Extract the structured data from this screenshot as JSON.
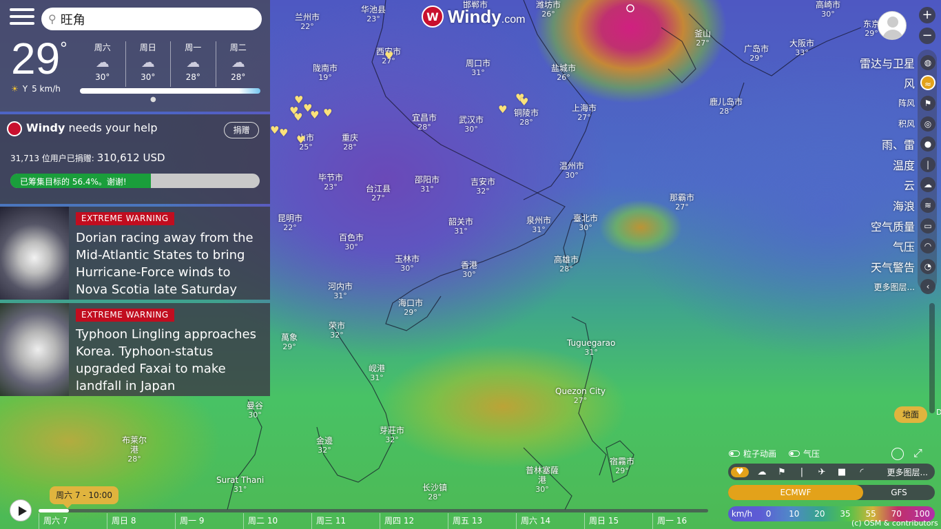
{
  "app": {
    "logo_main": "Windy",
    "logo_suffix": ".com"
  },
  "search": {
    "value": "旺角",
    "placeholder": "旺角"
  },
  "current": {
    "temperature": "29",
    "unit": "°",
    "wind": "5 km/h"
  },
  "forecast_days": [
    {
      "name": "周六",
      "temp": "30°",
      "icon": "thunderstorm-icon"
    },
    {
      "name": "周日",
      "temp": "30°",
      "icon": "thunderstorm-icon"
    },
    {
      "name": "周一",
      "temp": "28°",
      "icon": "thunderstorm-icon"
    },
    {
      "name": "周二",
      "temp": "28°",
      "icon": "thunderstorm-icon"
    }
  ],
  "help": {
    "brand": "Windy",
    "title_rest": "needs your help",
    "donate": "捐赠",
    "donors_text": "31,713 位用户已捐赠:",
    "amount": "310,612 USD",
    "progress_text": "已筹集目标的 56.4%。谢谢!",
    "progress_fraction": 0.564
  },
  "news": [
    {
      "badge": "EXTREME WARNING",
      "title": "Dorian racing away from the Mid-Atlantic States to bring Hurricane-Force winds to Nova Scotia late Saturday"
    },
    {
      "badge": "EXTREME WARNING",
      "title": "Typhoon Lingling approaches Korea. Typhoon-status upgraded Faxai to make landfall in Japan"
    }
  ],
  "cities": [
    {
      "name": "兰州市",
      "temp": "22°"
    },
    {
      "name": "华池县",
      "temp": "23°"
    },
    {
      "name": "邯郸市",
      "temp": ""
    },
    {
      "name": "潍坊市",
      "temp": "26°"
    },
    {
      "name": "高崎市",
      "temp": "30°"
    },
    {
      "name": "东京",
      "temp": "29°"
    },
    {
      "name": "釜山",
      "temp": "27°"
    },
    {
      "name": "大阪市",
      "temp": "33°"
    },
    {
      "name": "广岛市",
      "temp": "29°"
    },
    {
      "name": "西安市",
      "temp": "27°"
    },
    {
      "name": "陇南市",
      "temp": "19°"
    },
    {
      "name": "周口市",
      "temp": "31°"
    },
    {
      "name": "盐城市",
      "temp": "26°"
    },
    {
      "name": "鹿儿岛市",
      "temp": "28°"
    },
    {
      "name": "宜昌市",
      "temp": "28°"
    },
    {
      "name": "武汉市",
      "temp": "30°"
    },
    {
      "name": "铜陵市",
      "temp": "28°"
    },
    {
      "name": "上海市",
      "temp": "27°"
    },
    {
      "name": "重庆",
      "temp": "28°"
    },
    {
      "name": "山市",
      "temp": "25°"
    },
    {
      "name": "温州市",
      "temp": "30°"
    },
    {
      "name": "毕节市",
      "temp": "23°"
    },
    {
      "name": "台江县",
      "temp": "27°"
    },
    {
      "name": "邵阳市",
      "temp": "31°"
    },
    {
      "name": "吉安市",
      "temp": "32°"
    },
    {
      "name": "那霸市",
      "temp": "27°"
    },
    {
      "name": "昆明市",
      "temp": "22°"
    },
    {
      "name": "韶关市",
      "temp": "31°"
    },
    {
      "name": "泉州市",
      "temp": "31°"
    },
    {
      "name": "臺北市",
      "temp": "30°"
    },
    {
      "name": "百色市",
      "temp": "30°"
    },
    {
      "name": "玉林市",
      "temp": "30°"
    },
    {
      "name": "香港",
      "temp": "30°"
    },
    {
      "name": "高雄市",
      "temp": "28°"
    },
    {
      "name": "河内市",
      "temp": "31°"
    },
    {
      "name": "海口市",
      "temp": "29°"
    },
    {
      "name": "荣市",
      "temp": "32°"
    },
    {
      "name": "萬象",
      "temp": "29°"
    },
    {
      "name": "岘港",
      "temp": "31°"
    },
    {
      "name": "Tuguegarao",
      "temp": "31°"
    },
    {
      "name": "Quezon City",
      "temp": "27°"
    },
    {
      "name": "曼谷",
      "temp": "30°"
    },
    {
      "name": "芽莊市",
      "temp": "32°"
    },
    {
      "name": "金邊",
      "temp": "32°"
    },
    {
      "name": "布莱尔港",
      "temp": "28°"
    },
    {
      "name": "Surat Thani",
      "temp": "31°"
    },
    {
      "name": "长沙镇",
      "temp": "28°"
    },
    {
      "name": "普林塞薩港",
      "temp": "30°"
    },
    {
      "name": "宿霧市",
      "temp": "29°"
    }
  ],
  "layers": [
    {
      "label": "雷达与卫星",
      "icon": "globe-icon",
      "small": false
    },
    {
      "label": "风",
      "icon": "wind-icon",
      "small": false,
      "active": true
    },
    {
      "label": "阵风",
      "icon": "flag-icon",
      "small": true
    },
    {
      "label": "积风",
      "icon": "swirl-icon",
      "small": true
    },
    {
      "label": "雨、雷",
      "icon": "raindrop-icon",
      "small": false
    },
    {
      "label": "温度",
      "icon": "thermometer-icon",
      "small": false
    },
    {
      "label": "云",
      "icon": "cloud-icon",
      "small": false
    },
    {
      "label": "海浪",
      "icon": "waves-icon",
      "small": false
    },
    {
      "label": "空气质量",
      "icon": "car-icon",
      "small": false
    },
    {
      "label": "气压",
      "icon": "gauge-icon",
      "small": false
    },
    {
      "label": "天气警告",
      "icon": "warning-icon",
      "small": false
    },
    {
      "label": "更多图层...",
      "icon": "chevron-left-icon",
      "small": true
    }
  ],
  "ground_button": "地面",
  "ground_d": "D",
  "toggles": {
    "particles": "粒子动画",
    "pressure": "气压"
  },
  "quick_layers_more": "更多图层...",
  "models": {
    "active": "ECMWF",
    "other": "GFS"
  },
  "legend": {
    "unit": "km/h",
    "values": [
      "0",
      "10",
      "20",
      "35",
      "55",
      "70",
      "100"
    ]
  },
  "credit": "(c) OSM & contributors",
  "timeline": {
    "current": "周六 7 - 10:00",
    "progress_fraction": 0.045,
    "days": [
      "周六 7",
      "周日 8",
      "周一 9",
      "周二 10",
      "周三 11",
      "周四 12",
      "周五 13",
      "周六 14",
      "周日 15",
      "周一 16"
    ]
  },
  "colors": {
    "accent": "#e3a21a",
    "brand_red": "#c8102e",
    "warning_red": "#c10d1f",
    "progress_green": "#1a9e3b"
  }
}
